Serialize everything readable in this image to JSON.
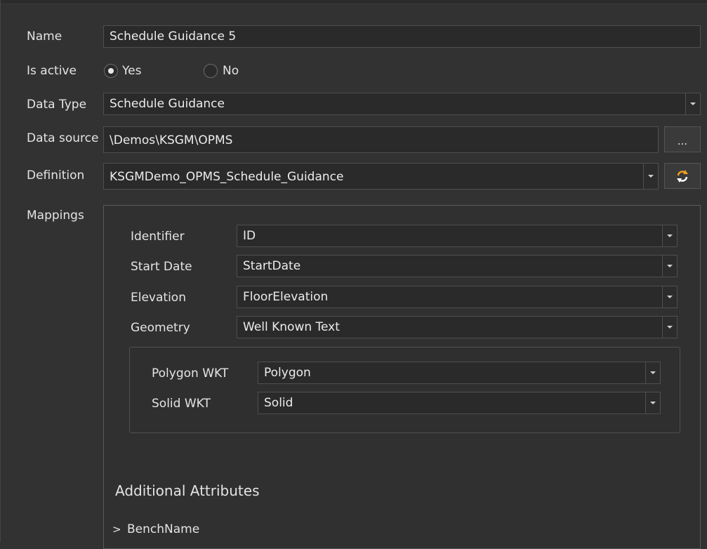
{
  "form": {
    "name_label": "Name",
    "name_value": "Schedule Guidance 5",
    "active_label": "Is active",
    "active_yes": "Yes",
    "active_no": "No",
    "active_selected": "Yes",
    "datatype_label": "Data Type",
    "datatype_value": "Schedule Guidance",
    "datasource_label": "Data source",
    "datasource_value": "\\Demos\\KSGM\\OPMS",
    "browse_label": "...",
    "definition_label": "Definition",
    "definition_value": "KSGMDemo_OPMS_Schedule_Guidance",
    "refresh_icon": "refresh-icon",
    "mappings_label": "Mappings"
  },
  "mappings": {
    "identifier_label": "Identifier",
    "identifier_value": "ID",
    "startdate_label": "Start Date",
    "startdate_value": "StartDate",
    "elevation_label": "Elevation",
    "elevation_value": "FloorElevation",
    "geometry_label": "Geometry",
    "geometry_value": "Well Known Text",
    "polygon_label": "Polygon WKT",
    "polygon_value": "Polygon",
    "solid_label": "Solid WKT",
    "solid_value": "Solid",
    "additional_title": "Additional Attributes",
    "expand_glyph": ">",
    "bench_label": "BenchName"
  },
  "colors": {
    "background": "#323232",
    "field": "#2a2a2a",
    "refresh_accent": "#f0a020"
  }
}
